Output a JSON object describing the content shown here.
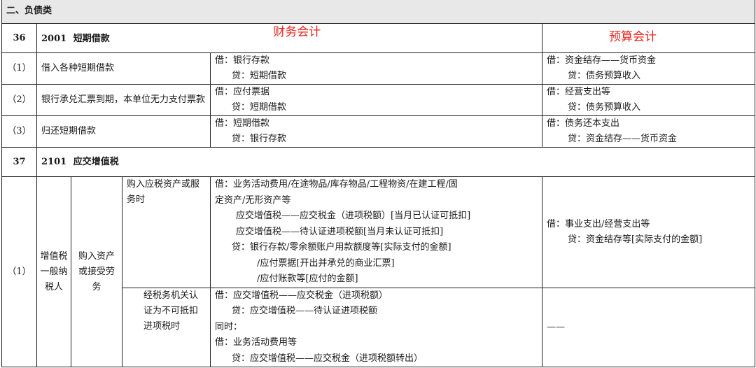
{
  "section": {
    "title": "二、负债类"
  },
  "items": [
    {
      "no": "36",
      "code": "2001",
      "name": "短期借款",
      "financial_header": "财务会计",
      "budget_header": "预算会计",
      "rows": [
        {
          "idx": "（1）",
          "desc": "借入各种短期借款",
          "fin": [
            "借：银行存款",
            "贷：短期借款"
          ],
          "bud": [
            "借：资金结存——货币资金",
            "贷：债务预算收入"
          ]
        },
        {
          "idx": "（2）",
          "desc": "银行承兑汇票到期，本单位无力支付票款",
          "fin": [
            "借：应付票据",
            "贷：短期借款"
          ],
          "bud": [
            "借：经营支出等",
            "贷：债务预算收入"
          ]
        },
        {
          "idx": "（3）",
          "desc": "归还短期借款",
          "fin": [
            "借：短期借款",
            "贷：银行存款"
          ],
          "bud": [
            "借：债务还本支出",
            "贷：资金结存——货币资金"
          ]
        }
      ]
    },
    {
      "no": "37",
      "code": "2101",
      "name": "应交增值税",
      "vat": {
        "idx": "（1）",
        "category": "增值税一般纳税人",
        "sub": "购入资产或接受劳务",
        "case1_desc": "购入应税资产或服务时",
        "case1_fin": [
          "借：业务活动费用/在途物品/库存物品/工程物资/在建工程/固",
          "定资产/无形资产等",
          "应交增值税——应交税金（进项税额）[当月已认证可抵扣]",
          "应交增值税——待认证进项税额[当月未认证可抵扣]",
          "贷：银行存款/零余额账户用款额度等[实际支付的金额]",
          "/应付票据[开出并承兑的商业汇票]",
          "/应付账款等[应付的金额]"
        ],
        "case1_bud": [
          "借：事业支出/经营支出等",
          "贷：资金结存等[实际支付的金额]"
        ],
        "case2_desc": "经税务机关认证为不可抵扣进项税时",
        "case2_fin": [
          "借：应交增值税——应交税金（进项税额）",
          "贷：应交增值税——待认证进项税额",
          "同时：",
          "借：业务活动费用等",
          "贷：应交增值税——应交税金（进项税额转出）"
        ],
        "case2_bud": "——"
      }
    }
  ]
}
